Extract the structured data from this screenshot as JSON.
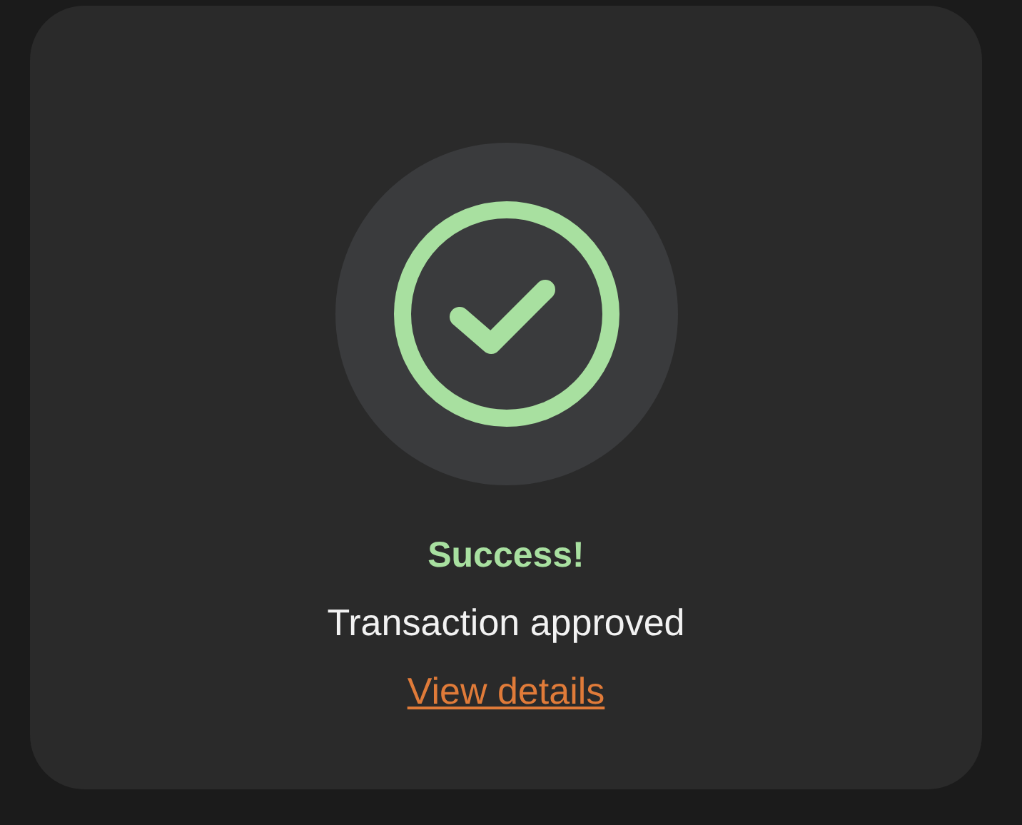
{
  "status": {
    "title": "Success!",
    "message": "Transaction approved",
    "link": "View details"
  }
}
